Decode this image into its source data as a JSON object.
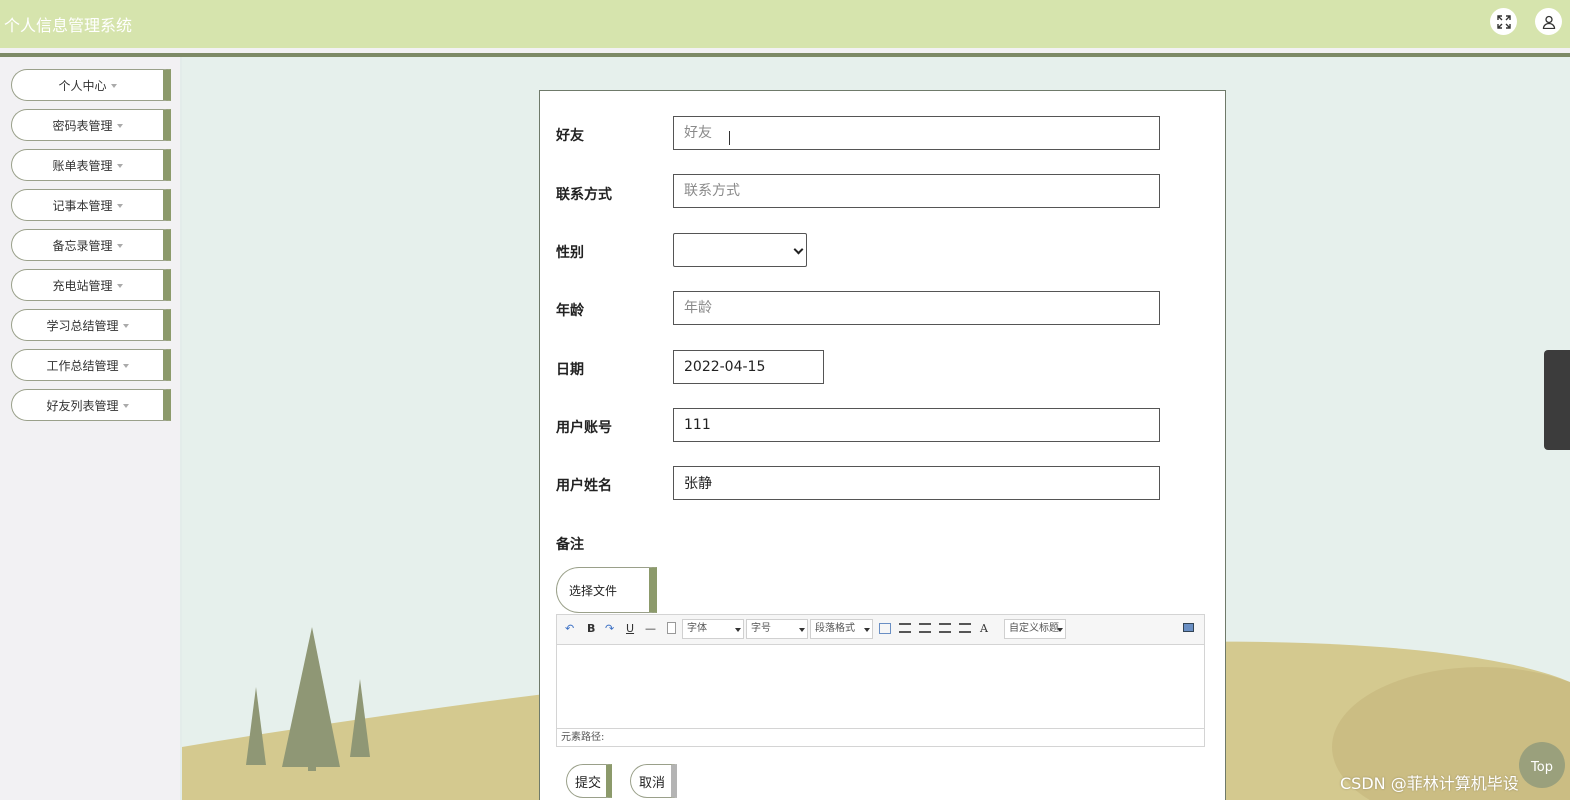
{
  "app": {
    "title": "个人信息管理系统"
  },
  "header": {
    "fullscreen_icon": "expand-icon",
    "user_icon": "user-icon"
  },
  "sidebar": {
    "items": [
      {
        "label": "个人中心"
      },
      {
        "label": "密码表管理"
      },
      {
        "label": "账单表管理"
      },
      {
        "label": "记事本管理"
      },
      {
        "label": "备忘录管理"
      },
      {
        "label": "充电站管理"
      },
      {
        "label": "学习总结管理"
      },
      {
        "label": "工作总结管理"
      },
      {
        "label": "好友列表管理"
      }
    ]
  },
  "form": {
    "friend": {
      "label": "好友",
      "placeholder": "好友",
      "value": ""
    },
    "contact": {
      "label": "联系方式",
      "placeholder": "联系方式",
      "value": ""
    },
    "gender": {
      "label": "性别",
      "value": ""
    },
    "age": {
      "label": "年龄",
      "placeholder": "年龄",
      "value": ""
    },
    "date": {
      "label": "日期",
      "value": "2022-04-15"
    },
    "account": {
      "label": "用户账号",
      "value": "111"
    },
    "name": {
      "label": "用户姓名",
      "value": "张静"
    },
    "remark": {
      "label": "备注"
    },
    "file_button": "选择文件",
    "editor": {
      "toolbar": {
        "undo_icon": "undo-icon",
        "bold": "B",
        "redo_icon": "redo-icon",
        "underline": "U",
        "hr": "—",
        "font_family": "字体",
        "font_size": "字号",
        "paragraph": "段落格式",
        "font_color": "A",
        "custom_title": "自定义标题"
      },
      "path_label": "元素路径:"
    },
    "submit": "提交",
    "cancel": "取消"
  },
  "floating": {
    "top_button": "Top"
  },
  "watermark": "CSDN @菲林计算机毕设",
  "colors": {
    "header": "#d6e4ad",
    "accent": "#8c9a6b",
    "hill": "#d4c98f",
    "tree": "#8f9775"
  }
}
